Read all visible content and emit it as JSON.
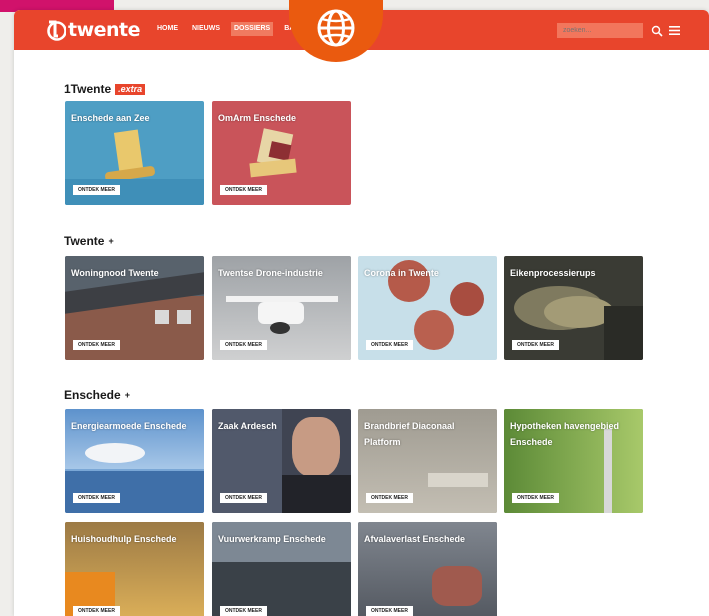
{
  "logo": {
    "text": "twente"
  },
  "nav": {
    "items": [
      {
        "label": "HOME"
      },
      {
        "label": "NIEUWS"
      },
      {
        "label": "DOSSIERS",
        "active": true
      },
      {
        "label": "BA"
      }
    ]
  },
  "search": {
    "placeholder": "zoeken..."
  },
  "icons": {
    "search": "search-icon",
    "menu": "menu-icon",
    "globe": "globe-icon",
    "logo": "logo-mark-icon"
  },
  "colors": {
    "brand_red": "#e8452c",
    "badge_orange": "#ea5a0f",
    "corner_pink": "#d1126b"
  },
  "sections": [
    {
      "title": "1Twente",
      "badge": ".extra",
      "tiles": [
        {
          "title": "Enschede aan Zee",
          "button": "ONTDEK MEER"
        },
        {
          "title": "OmArm Enschede",
          "button": "ONTDEK MEER"
        }
      ]
    },
    {
      "title": "Twente",
      "plus": "+",
      "tiles": [
        {
          "title": "Woningnood Twente",
          "button": "ONTDEK MEER"
        },
        {
          "title": "Twentse Drone-industrie",
          "button": "ONTDEK MEER"
        },
        {
          "title": "Corona in Twente",
          "button": "ONTDEK MEER"
        },
        {
          "title": "Eikenprocessierups",
          "button": "ONTDEK MEER"
        }
      ]
    },
    {
      "title": "Enschede",
      "plus": "+",
      "tiles": [
        {
          "title": "Energiearmoede Enschede",
          "button": "ONTDEK MEER"
        },
        {
          "title": "Zaak Ardesch",
          "button": "ONTDEK MEER"
        },
        {
          "title": "Brandbrief Diaconaal Platform",
          "button": "ONTDEK MEER"
        },
        {
          "title": "Hypotheken havengebied Enschede",
          "button": "ONTDEK MEER"
        },
        {
          "title": "Huishoudhulp Enschede",
          "button": "ONTDEK MEER"
        },
        {
          "title": "Vuurwerkramp Enschede",
          "button": "ONTDEK MEER"
        },
        {
          "title": "Afvalaverlast Enschede",
          "button": "ONTDEK MEER"
        }
      ]
    }
  ]
}
